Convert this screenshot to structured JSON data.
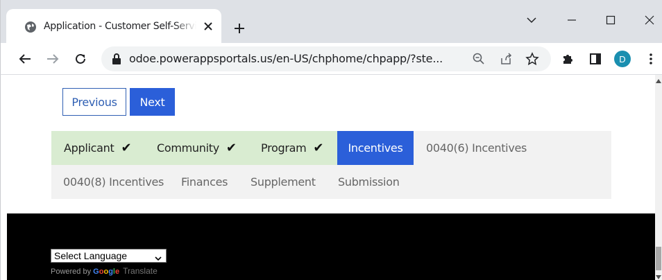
{
  "browser": {
    "tab": {
      "title": "Application - Customer Self-Service",
      "favicon": "globe-icon"
    },
    "window_controls": [
      "chevron-down-icon",
      "minimize-icon",
      "maximize-icon",
      "close-icon"
    ],
    "url": "odoe.powerappsportals.us/en-US/chphome/chpapp/?ste...",
    "profile_initial": "D",
    "profile_color": "#1a8fb0"
  },
  "nav": {
    "previous_label": "Previous",
    "next_label": "Next"
  },
  "steps": {
    "row1": [
      {
        "label": "Applicant",
        "state": "done"
      },
      {
        "label": "Community",
        "state": "done"
      },
      {
        "label": "Program",
        "state": "done"
      },
      {
        "label": "Incentives",
        "state": "active"
      },
      {
        "label": "0040(6) Incentives",
        "state": "future"
      }
    ],
    "row2": [
      {
        "label": "0040(8) Incentives",
        "state": "future"
      },
      {
        "label": "Finances",
        "state": "future"
      },
      {
        "label": "Supplement",
        "state": "future"
      },
      {
        "label": "Submission",
        "state": "future"
      }
    ],
    "check_glyph": "✔"
  },
  "footer": {
    "language_select": "Select Language",
    "powered_by": "Powered by",
    "google": [
      "G",
      "o",
      "o",
      "g",
      "l",
      "e"
    ],
    "translate": "Translate"
  },
  "colors": {
    "accent": "#2b5fd9",
    "done_step": "#d9ecd1",
    "steps_bg": "#f2f2f2"
  }
}
